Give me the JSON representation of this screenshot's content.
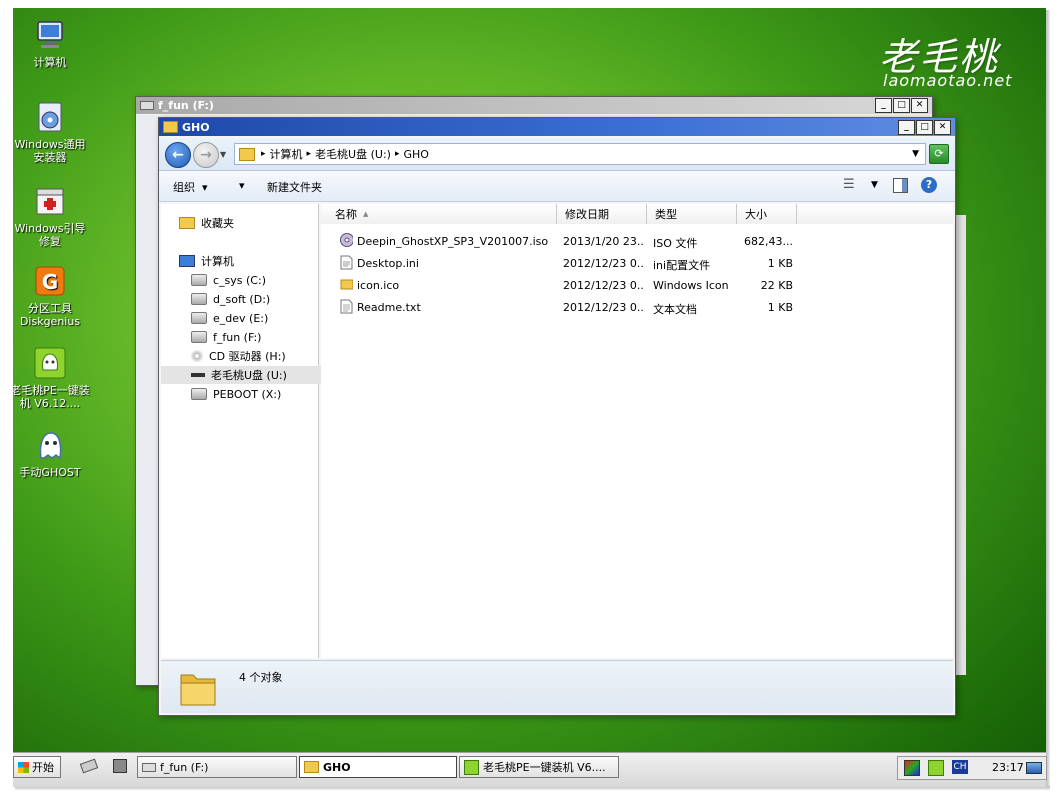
{
  "logo": {
    "cn": "老毛桃",
    "en": "laomaotao.net"
  },
  "desktop_icons": [
    {
      "label": "计算机",
      "icon": "computer-icon"
    },
    {
      "label": "Windows通用安装器",
      "icon": "installer-icon"
    },
    {
      "label": "Windows引导修复",
      "icon": "repair-icon"
    },
    {
      "label": "分区工具Diskgenius",
      "icon": "diskgenius-icon"
    },
    {
      "label": "老毛桃PE一键装机 V6.12....",
      "icon": "laomaotao-icon"
    },
    {
      "label": "手动GHOST",
      "icon": "ghost-icon"
    }
  ],
  "back_window": {
    "title": "f_fun (F:)"
  },
  "front_window": {
    "title": "GHO",
    "address": {
      "computer": "计算机",
      "drive": "老毛桃U盘 (U:)",
      "folder": "GHO"
    },
    "toolbar": {
      "organize": "组织",
      "new_folder": "新建文件夹"
    },
    "nav": {
      "favorites": "收藏夹",
      "computer": "计算机",
      "drives": [
        "c_sys (C:)",
        "d_soft (D:)",
        "e_dev (E:)",
        "f_fun (F:)",
        "CD 驱动器 (H:)",
        "老毛桃U盘 (U:)",
        "PEBOOT (X:)"
      ]
    },
    "columns": {
      "name": "名称",
      "date": "修改日期",
      "type": "类型",
      "size": "大小"
    },
    "files": [
      {
        "name": "Deepin_GhostXP_SP3_V201007.iso",
        "date": "2013/1/20 23...",
        "type": "ISO 文件",
        "size": "682,43..."
      },
      {
        "name": "Desktop.ini",
        "date": "2012/12/23 0...",
        "type": "ini配置文件",
        "size": "1 KB"
      },
      {
        "name": "icon.ico",
        "date": "2012/12/23 0...",
        "type": "Windows Icon",
        "size": "22 KB"
      },
      {
        "name": "Readme.txt",
        "date": "2012/12/23 0...",
        "type": "文本文档",
        "size": "1 KB"
      }
    ],
    "status": "4 个对象"
  },
  "taskbar": {
    "start": "开始",
    "buttons": [
      "f_fun (F:)",
      "GHO",
      "老毛桃PE一键装机 V6...."
    ],
    "tray_lang": "CH",
    "clock": "23:17"
  },
  "colors": {
    "title_active": "#1d49a8",
    "desktop_green": "#4fa81e"
  }
}
